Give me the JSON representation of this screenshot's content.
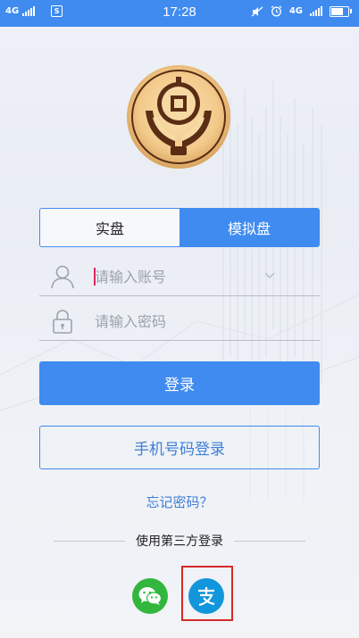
{
  "status_bar": {
    "network_left": "4G",
    "sim_label": "S",
    "time": "17:28",
    "network_right": "4G",
    "icons": [
      "signal-icon",
      "sim-icon",
      "mute-icon",
      "alarm-icon",
      "signal-icon",
      "battery-icon"
    ]
  },
  "logo": {
    "icon": "coin-hands-logo-icon"
  },
  "mode_tabs": {
    "real_label": "实盘",
    "simulated_label": "模拟盘",
    "active": "simulated"
  },
  "account_field": {
    "placeholder": "请输入账号",
    "icon": "user-icon",
    "dropdown_icon": "chevron-down-icon"
  },
  "password_field": {
    "placeholder": "请输入密码",
    "icon": "lock-icon"
  },
  "login_button_label": "登录",
  "phone_login_label": "手机号码登录",
  "forgot_password_label": "忘记密码？",
  "third_party_label": "使用第三方登录",
  "social_logins": [
    {
      "name": "wechat",
      "icon": "wechat-icon",
      "color": "#33b63d"
    },
    {
      "name": "alipay",
      "icon": "alipay-icon",
      "color": "#1296db",
      "highlighted": true
    }
  ],
  "colors": {
    "accent": "#3f8bf0",
    "highlight": "#d42a2a"
  }
}
